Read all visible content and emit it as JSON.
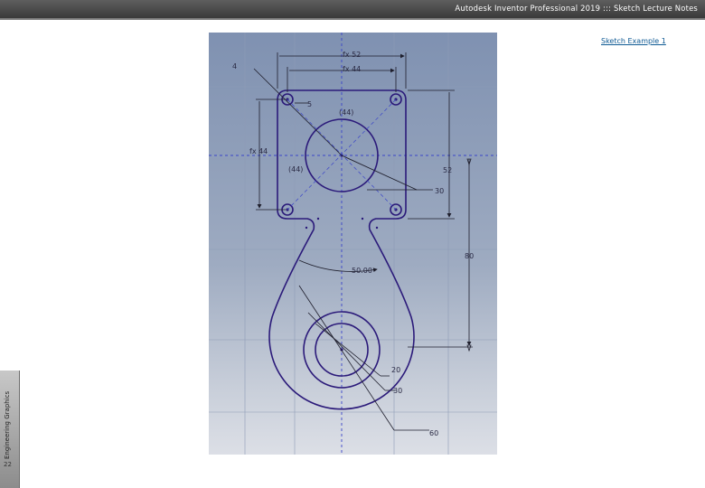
{
  "header": {
    "title": "Autodesk Inventor Professional 2019 ::: Sketch Lecture Notes"
  },
  "link": {
    "label": "Sketch Example 1"
  },
  "sidebar": {
    "label": "Engineering Graphics",
    "page_number": "22"
  },
  "sketch": {
    "dimensions": {
      "top_outer": "fx 52",
      "top_inner": "fx 44",
      "left_outer": "fx 44",
      "hole_dia": "5",
      "ref_top": "(44)",
      "ref_left": "(44)",
      "right_height": "52",
      "center_circle": "30",
      "neck_angle": "50.00",
      "overall_height": "80",
      "bottom_inner": "20",
      "bottom_mid": "30",
      "bottom_outer": "60",
      "corner_label": "4"
    },
    "colors": {
      "geometry": "#2b1a7a",
      "dimension": "#1e1e2c",
      "centerline": "#3a44c8"
    }
  }
}
